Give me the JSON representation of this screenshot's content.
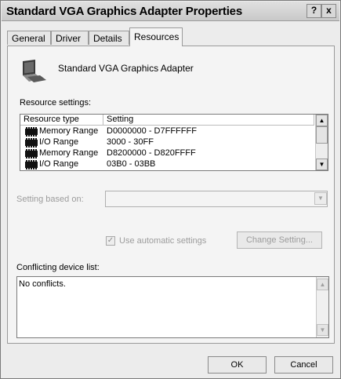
{
  "window": {
    "title": "Standard VGA Graphics Adapter Properties",
    "help_button": "?",
    "close_button": "x"
  },
  "tabs": [
    {
      "label": "General"
    },
    {
      "label": "Driver"
    },
    {
      "label": "Details"
    },
    {
      "label": "Resources",
      "active": true
    }
  ],
  "device": {
    "name": "Standard VGA Graphics Adapter",
    "icon": "monitor-icon"
  },
  "resource_settings": {
    "label": "Resource settings:",
    "columns": [
      "Resource type",
      "Setting"
    ],
    "rows": [
      {
        "type": "Memory Range",
        "setting": "D0000000 - D7FFFFFF",
        "icon": "chip-icon"
      },
      {
        "type": "I/O Range",
        "setting": "3000 - 30FF",
        "icon": "chip-icon"
      },
      {
        "type": "Memory Range",
        "setting": "D8200000 - D820FFFF",
        "icon": "chip-icon"
      },
      {
        "type": "I/O Range",
        "setting": "03B0 - 03BB",
        "icon": "chip-icon"
      }
    ]
  },
  "setting_based_on": {
    "label": "Setting based on:",
    "value": ""
  },
  "automatic": {
    "label": "Use automatic settings",
    "checked": true
  },
  "change_setting_label": "Change Setting...",
  "conflicts": {
    "label": "Conflicting device list:",
    "text": "No conflicts."
  },
  "footer": {
    "ok_label": "OK",
    "cancel_label": "Cancel"
  }
}
